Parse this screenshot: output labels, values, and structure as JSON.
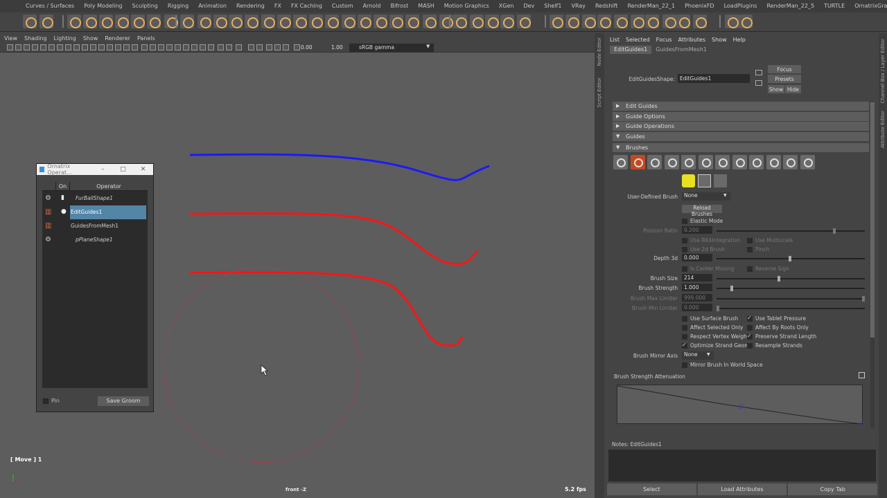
{
  "shelf": {
    "tabs": [
      "Curves / Surfaces",
      "Poly Modeling",
      "Sculpting",
      "Rigging",
      "Animation",
      "Rendering",
      "FX",
      "FX Caching",
      "Custom",
      "Arnold",
      "Bifrost",
      "MASH",
      "Motion Graphics",
      "XGen",
      "Dev",
      "Shelf1",
      "VRay",
      "Redshift",
      "RenderMan_22_1",
      "PhoenixFD",
      "LoadPlugins",
      "RenderMan_22_5",
      "TURTLE",
      "OrnatrixGraph",
      "Ornatrix"
    ],
    "active_tab": "Ornatrix"
  },
  "viewport": {
    "menu": [
      "View",
      "Shading",
      "Lighting",
      "Show",
      "Renderer",
      "Panels"
    ],
    "exposure": "0.00",
    "gamma": "1.00",
    "color_space": "sRGB gamma",
    "tool_status": "[ Move ] 1",
    "camera_label": "front -Z",
    "fps": "5.2 fps",
    "colors": {
      "guide_selected": "#1a1aff",
      "guide": "#ff1414",
      "brush_circle": "#c83250"
    }
  },
  "operator_window": {
    "title": "Ornatrix Operat...",
    "col_on": "On",
    "col_operator": "Operator",
    "rows": [
      {
        "name": "FurBallShape1",
        "icon": "gear-icon",
        "italic": true
      },
      {
        "name": "EditGuides1",
        "icon": "edit-guides-icon",
        "selected": true
      },
      {
        "name": "GuidesFromMesh1",
        "icon": "guides-from-mesh-icon"
      },
      {
        "name": "pPlaneShape1",
        "icon": "gear-icon",
        "italic": true
      }
    ],
    "pin_label": "Pin",
    "save_label": "Save Groom"
  },
  "side_strips": {
    "node_editor": "Node Editor",
    "script_editor": "Script Editor",
    "channel_box": "Channel Box / Layer Editor",
    "attribute_editor": "Attribute Editor"
  },
  "attribute_editor": {
    "menu": [
      "List",
      "Selected",
      "Focus",
      "Attributes",
      "Show",
      "Help"
    ],
    "tabs": [
      "EditGuides1",
      "GuidesFromMesh1"
    ],
    "shape_label": "EditGuidesShape:",
    "shape_value": "EditGuides1",
    "focus_label": "Focus",
    "presets_label": "Presets",
    "show_label": "Show",
    "hide_label": "Hide",
    "sections": [
      "Edit Guides",
      "Guide Options",
      "Guide Operations",
      "Guides",
      "Brushes"
    ],
    "user_defined_brush_label": "User-Defined Brush",
    "user_defined_brush_value": "None",
    "reload_brushes_label": "Reload Brushes",
    "elastic_mode": "Elastic Mode",
    "poisson_ratio_label": "Poisson Ratio",
    "poisson_ratio_value": "0.200",
    "use_rk4": "Use RK4Integration",
    "use_multiscale": "Use Multiscale",
    "use_2d_brush": "Use 2d Brush",
    "pinch": "Pinch",
    "depth3d_label": "Depth 3d",
    "depth3d_value": "0.000",
    "is_center_moving": "Is Center Moving",
    "reverse_sign": "Reverse Sign",
    "brush_size_label": "Brush Size",
    "brush_size_value": "214",
    "brush_strength_label": "Brush Strength",
    "brush_strength_value": "1.000",
    "brush_max_limiter_label": "Brush Max Limiter",
    "brush_max_limiter_value": "999.000",
    "brush_min_limiter_label": "Brush Min Limiter",
    "brush_min_limiter_value": "0.000",
    "use_surface_brush": "Use Surface Brush",
    "use_tablet_pressure": "Use Tablet Pressure",
    "affect_selected_only": "Affect Selected Only",
    "affect_by_roots_only": "Affect By Roots Only",
    "respect_vertex_weights": "Respect Vertex Weights",
    "preserve_strand_length": "Preserve Strand Length",
    "optimize_strand_geom": "Optimize Strand Geome",
    "resample_strands": "Resample Strands",
    "mirror_axis_label": "Brush Mirror Axis",
    "mirror_axis_value": "None",
    "mirror_world_space": "Mirror Brush In World Space",
    "attenuation_label": "Brush Strength Attenuation",
    "notes_label": "Notes:  EditGuides1",
    "bottom_buttons": [
      "Select",
      "Load Attributes",
      "Copy Tab"
    ]
  }
}
